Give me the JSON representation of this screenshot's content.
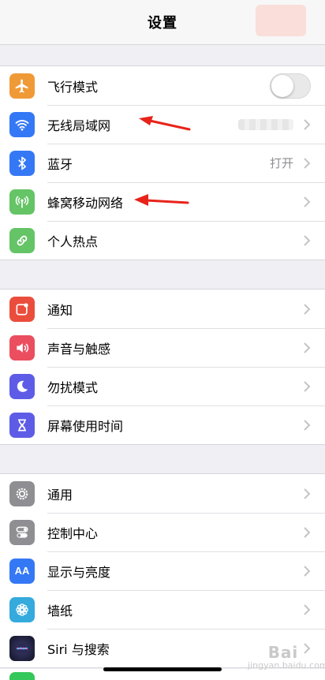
{
  "navbar": {
    "title": "设置"
  },
  "groups": [
    {
      "rows": [
        {
          "label": "飞行模式",
          "icon": "airplane-icon",
          "icon_color": "#f09a37",
          "accessory": "toggle",
          "toggle_on": false
        },
        {
          "label": "无线局域网",
          "icon": "wifi-icon",
          "icon_color": "#3478f6",
          "accessory": "blurred-value"
        },
        {
          "label": "蓝牙",
          "icon": "bluetooth-icon",
          "icon_color": "#3478f6",
          "value": "打开"
        },
        {
          "label": "蜂窝移动网络",
          "icon": "cellular-antenna-icon",
          "icon_color": "#65c466"
        },
        {
          "label": "个人热点",
          "icon": "hotspot-link-icon",
          "icon_color": "#65c466"
        }
      ]
    },
    {
      "rows": [
        {
          "label": "通知",
          "icon": "notification-icon",
          "icon_color": "#eb4d3d"
        },
        {
          "label": "声音与触感",
          "icon": "speaker-icon",
          "icon_color": "#eb4e5e"
        },
        {
          "label": "勿扰模式",
          "icon": "moon-icon",
          "icon_color": "#5e5ce6"
        },
        {
          "label": "屏幕使用时间",
          "icon": "hourglass-icon",
          "icon_color": "#5e5ce6"
        }
      ]
    },
    {
      "rows": [
        {
          "label": "通用",
          "icon": "gear-icon",
          "icon_color": "#8e8e93"
        },
        {
          "label": "控制中心",
          "icon": "control-toggles-icon",
          "icon_color": "#8e8e93"
        },
        {
          "label": "显示与亮度",
          "icon": "text-size-icon",
          "icon_color": "#3478f6",
          "icon_text": "AA"
        },
        {
          "label": "墙纸",
          "icon": "flower-icon",
          "icon_color": "#35aadc"
        },
        {
          "label": "Siri 与搜索",
          "icon": "siri-icon",
          "icon_color": "#1c1c3a"
        }
      ]
    }
  ],
  "annotations": {
    "arrow_color": "#e8231a"
  },
  "watermark": {
    "line1": "Bai",
    "line2": "jingyan.baidu.com"
  }
}
